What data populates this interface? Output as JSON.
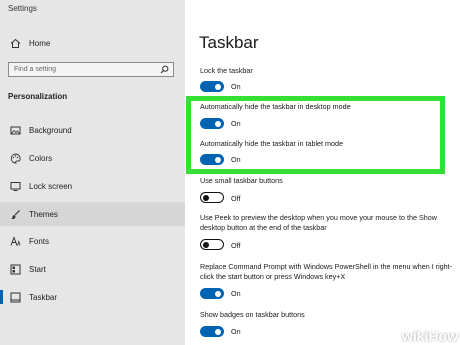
{
  "app": {
    "title": "Settings"
  },
  "sidebar": {
    "home": "Home",
    "search_placeholder": "Find a setting",
    "section_title": "Personalization",
    "items": [
      {
        "label": "Background",
        "icon": "image-icon"
      },
      {
        "label": "Colors",
        "icon": "palette-icon"
      },
      {
        "label": "Lock screen",
        "icon": "monitor-icon"
      },
      {
        "label": "Themes",
        "icon": "brush-icon"
      },
      {
        "label": "Fonts",
        "icon": "font-icon"
      },
      {
        "label": "Start",
        "icon": "start-icon"
      },
      {
        "label": "Taskbar",
        "icon": "taskbar-icon"
      }
    ]
  },
  "main": {
    "title": "Taskbar",
    "settings": [
      {
        "label": "Lock the taskbar",
        "state": "On"
      },
      {
        "label": "Automatically hide the taskbar in desktop mode",
        "state": "On"
      },
      {
        "label": "Automatically hide the taskbar in tablet mode",
        "state": "On"
      },
      {
        "label": "Use small taskbar buttons",
        "state": "Off"
      },
      {
        "label": "Use Peek to preview the desktop when you move your mouse to the Show desktop button at the end of the taskbar",
        "state": "Off"
      },
      {
        "label": "Replace Command Prompt with Windows PowerShell in the menu when I right-click the start button or press Windows key+X",
        "state": "On"
      },
      {
        "label": "Show badges on taskbar buttons",
        "state": "On"
      }
    ]
  },
  "watermark": {
    "wiki": "wiki",
    "how": "How"
  },
  "colors": {
    "accent": "#0063b1",
    "highlight": "#34e034",
    "sidebar_bg": "#e6e6e6"
  }
}
